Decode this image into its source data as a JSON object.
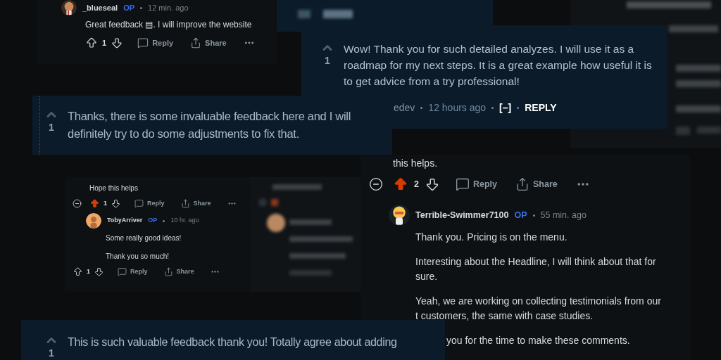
{
  "comments": [
    {
      "kind": "new",
      "comment": {
        "author": "_blueseal",
        "op": "OP",
        "time": "12 min. ago",
        "paragraphs": [
          [
            "Great feedback ▤. I will improve the website"
          ]
        ],
        "actions": {
          "upvoted": false,
          "score": "1",
          "reply": "Reply",
          "share": "Share"
        }
      }
    },
    {
      "kind": "old",
      "score": "1",
      "text": "Wow! Thank you for such detailed analyzes. I will use it as a roadmap for my next steps. It is a great example how useful it is to get advice from a try professional!",
      "meta": {
        "author": "edev",
        "time": "12 hours ago",
        "collapse": "[–]",
        "reply": "REPLY"
      }
    },
    {
      "kind": "old",
      "score": "1",
      "text": "Thanks, there is some invaluable feedback here and I will definitely try to do some adjustments to fix that."
    },
    {
      "kind": "new",
      "parent": {
        "tail": "this helps.",
        "actions": {
          "upvoted": true,
          "score": "2",
          "reply": "Reply",
          "share": "Share"
        }
      },
      "comment": {
        "author": "Terrible-Swimmer7100",
        "op": "OP",
        "time": "55 min. ago",
        "paragraphs": [
          [
            "Thank you. Pricing is on the menu."
          ],
          [
            "Interesting about the Headline, I will think about that for sure."
          ],
          [
            "Yeah, we are working on collecting testimonials from our",
            "t customers, the same with case studies."
          ],
          [
            "you for the time to make these comments."
          ]
        ]
      }
    },
    {
      "kind": "new",
      "parent": {
        "tail": "Hope this helps",
        "actions": {
          "upvoted": true,
          "score": "1",
          "reply": "Reply",
          "share": "Share"
        }
      },
      "comment": {
        "author": "TobyArriver",
        "op": "OP",
        "time": "10 hr. ago",
        "paragraphs": [
          [
            "Some really good ideas!"
          ],
          [
            "Thank you so much!"
          ]
        ],
        "actions": {
          "upvoted": false,
          "score": "1",
          "reply": "Reply",
          "share": "Share"
        }
      }
    },
    {
      "kind": "old",
      "score": "1",
      "text": "This is such valuable feedback thank you! Totally agree about adding"
    }
  ]
}
